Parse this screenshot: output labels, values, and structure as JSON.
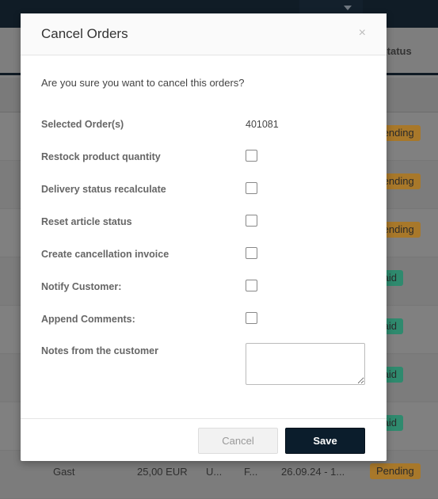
{
  "background": {
    "column_header_status": "Status",
    "rows": [
      {
        "status": "Pending",
        "type": "pending"
      },
      {
        "status": "Pending",
        "type": "pending"
      },
      {
        "status": "Pending",
        "type": "pending"
      },
      {
        "status": "Paid",
        "type": "paid"
      },
      {
        "status": "Paid",
        "type": "paid"
      },
      {
        "status": "Paid",
        "type": "paid"
      },
      {
        "status": "Paid",
        "type": "paid"
      },
      {
        "customer": "Gast",
        "amount": "25,00 EUR",
        "col3": "U...",
        "col4": "F...",
        "date": "26.09.24 - 1...",
        "status": "Pending",
        "type": "pending"
      }
    ]
  },
  "modal": {
    "title": "Cancel Orders",
    "close_icon": "×",
    "question": "Are you sure you want to cancel this orders?",
    "selected_label": "Selected Order(s)",
    "selected_value": "401081",
    "options": [
      {
        "label": "Restock product quantity",
        "checked": false
      },
      {
        "label": "Delivery status recalculate",
        "checked": false
      },
      {
        "label": "Reset article status",
        "checked": false
      },
      {
        "label": "Create cancellation invoice",
        "checked": false
      },
      {
        "label": "Notify Customer:",
        "checked": false
      },
      {
        "label": "Append Comments:",
        "checked": false
      }
    ],
    "notes_label": "Notes from the customer",
    "notes_value": "",
    "cancel_label": "Cancel",
    "save_label": "Save"
  },
  "colors": {
    "pending": "#a8782a",
    "paid": "#2f8a6e",
    "save": "#0b1d2c"
  }
}
